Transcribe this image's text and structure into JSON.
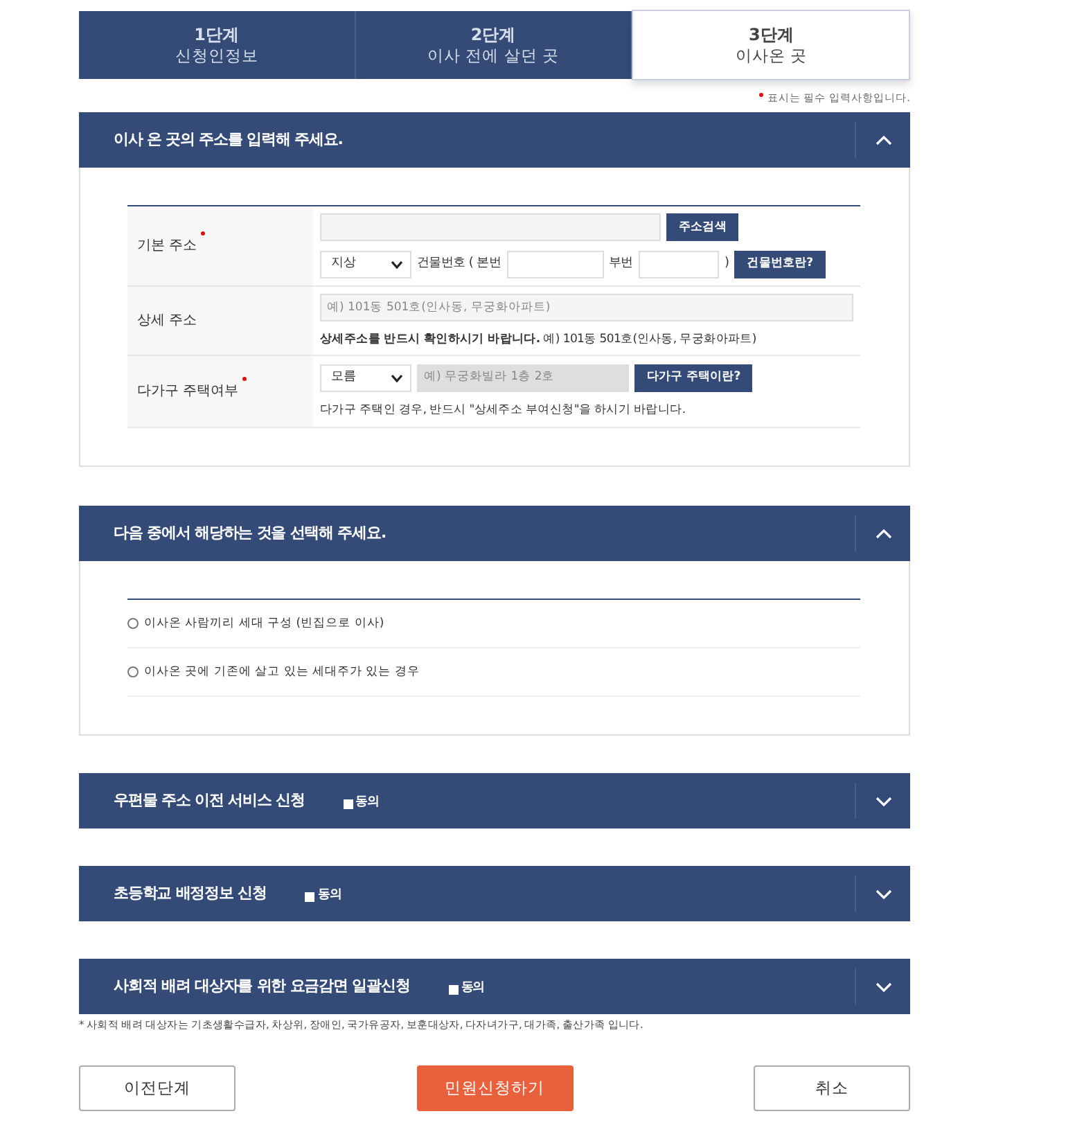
{
  "steps": [
    {
      "number": "1단계",
      "label": "신청인정보",
      "selected": false
    },
    {
      "number": "2단계",
      "label": "이사 전에 살던 곳",
      "selected": false
    },
    {
      "number": "3단계",
      "label": "이사온 곳",
      "selected": true
    }
  ],
  "required_note": "표시는 필수 입력사항입니다.",
  "sections": [
    {
      "kind": "address",
      "title": "이사 온 곳의 주소를 입력해 주세요.",
      "expanded": true,
      "rows": [
        {
          "label": "기본 주소",
          "required": true,
          "controls": [
            {
              "kind": "input"
            },
            {
              "kind": "button",
              "text": "주소검색"
            },
            {
              "kind": "break"
            },
            {
              "kind": "select",
              "value": "지상"
            },
            {
              "kind": "text",
              "text": "건물번호 ( 본번"
            },
            {
              "kind": "input"
            },
            {
              "kind": "text",
              "text": "부번"
            },
            {
              "kind": "input"
            },
            {
              "kind": "text",
              "text": ")"
            },
            {
              "kind": "button",
              "text": "건물번호란?"
            }
          ]
        },
        {
          "label": "상세 주소",
          "required": false,
          "controls": [
            {
              "kind": "input",
              "placeholder": "예) 101동 501호(인사동, 무궁화아파트)"
            },
            {
              "kind": "break"
            },
            {
              "kind": "note",
              "text": "**상세주소를 반드시 확인하시기 바랍니다.** 예) 101동 501호(인사동, 무궁화아파트)"
            }
          ]
        },
        {
          "label": "다가구 주택여부",
          "required": true,
          "controls": [
            {
              "kind": "select",
              "value": "모름"
            },
            {
              "kind": "input",
              "placeholder": "예) 무궁화빌라 1층 2호",
              "disabled": true
            },
            {
              "kind": "button",
              "text": "다가구 주택이란?"
            },
            {
              "kind": "break"
            },
            {
              "kind": "note",
              "text": "다가구 주택인 경우, 반드시 \"상세주소 부여신청\"을 하시기 바랍니다."
            }
          ]
        }
      ]
    },
    {
      "kind": "options",
      "title": "다음 중에서 해당하는 것을 선택해 주세요.",
      "expanded": true,
      "options": [
        {
          "label": "이사온 사람끼리 세대 구성 (빈집으로 이사)",
          "selected": false
        },
        {
          "label": "이사온 곳에 기존에 살고 있는 세대주가 있는 경우",
          "selected": false
        }
      ]
    },
    {
      "kind": "consent",
      "title": "우편물 주소 이전 서비스 신청",
      "expanded": false,
      "consent": "동의"
    },
    {
      "kind": "consent",
      "title": "초등학교 배정정보 신청",
      "expanded": false,
      "consent": "동의"
    },
    {
      "kind": "consent",
      "title": "사회적 배려 대상자를 위한 요금감면 일괄신청",
      "expanded": false,
      "consent": "동의"
    }
  ],
  "footnote": "* 사회적 배려 대상자는 기초생활수급자, 차상위, 장애인, 국가유공자, 보훈대상자, 다자녀가구, 대가족, 출산가족 입니다.",
  "buttons": [
    {
      "label": "이전단계",
      "kind": "outline"
    },
    {
      "label": "민원신청하기",
      "kind": "primary"
    },
    {
      "label": "취소",
      "kind": "outline"
    }
  ]
}
